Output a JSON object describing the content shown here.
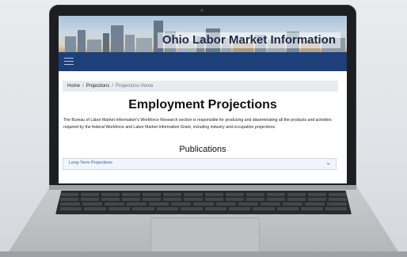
{
  "site": {
    "banner_title": "Ohio Labor Market Information"
  },
  "breadcrumb": {
    "items": [
      "Home",
      "Projections"
    ],
    "current": "Projections Home",
    "separator": "/"
  },
  "page": {
    "title": "Employment Projections",
    "intro": "The Bureau of Labor Market Information's Workforce Research section is responsible for producing and disseminating all the products and activities required by the federal Workforce and Labor Market Information Grant, including industry and occupation projections.",
    "publications_heading": "Publications"
  },
  "accordion": {
    "items": [
      {
        "label": "Long-Term Projections",
        "icon": "chevron-down-icon",
        "chevron": "⌄"
      }
    ]
  },
  "icons": {
    "menu": "hamburger-menu-icon"
  },
  "colors": {
    "nav": "#1d3f7a",
    "link": "#2a5db0",
    "breadcrumb_bg": "#e9ecef"
  }
}
